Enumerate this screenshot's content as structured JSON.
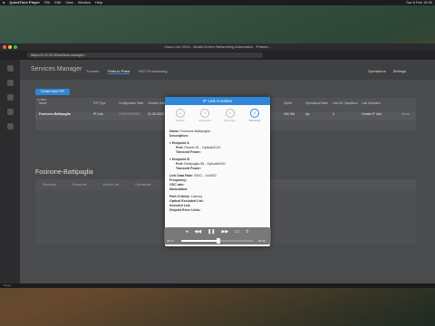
{
  "menubar": {
    "app": "QuickTime Player",
    "items": [
      "File",
      "Edit",
      "View",
      "Window",
      "Help"
    ],
    "clock": "Tue 6 Feb 15:39"
  },
  "browser": {
    "tab_title": "Cisco Live 2024 - Model-Driven Networking Automation - Prasha...",
    "url": "https://10.10.20.50/services-manager/..."
  },
  "app": {
    "title": "Services Manager",
    "tabs": [
      "Tunnels",
      "Point to Point",
      "NSO Provisioning"
    ],
    "active_tab": "Point to Point",
    "header_right": [
      "Operations",
      "Settings"
    ],
    "create_button": "Create New P2P",
    "table": {
      "count": "1 ITEM",
      "headers": [
        "Name",
        "P2P Type",
        "Configuration State",
        "Creation Date",
        "",
        "",
        "",
        "",
        "Speed",
        "Operational State",
        "Last Alt. Operations",
        "Last Operation"
      ],
      "rows": [
        [
          "Fosinone-Battipaglia",
          "IP Link",
          "CONFIGURED",
          "21-02-2024 11:...",
          "",
          "",
          "",
          "",
          "400 GB",
          "Up",
          "2",
          "Create IP Link"
        ]
      ],
      "row_action": "Show"
    },
    "detail": {
      "title": "Fosinone-Battipaglia",
      "tabs": [
        "Summary",
        "Endpoints",
        "Include List",
        "Operations"
      ]
    }
  },
  "modal": {
    "title": "IP Link Creation",
    "steps": [
      {
        "num": "1",
        "label": "Details"
      },
      {
        "num": "2",
        "label": "Endpoints"
      },
      {
        "num": "3",
        "label": "Recovery"
      },
      {
        "num": "4",
        "label": "Summary"
      }
    ],
    "summary": {
      "name_label": "Name:",
      "name_value": "Fosinone-Battipaglia",
      "desc_label": "Description:",
      "endpoint_a": {
        "title": "Endpoint A",
        "port_label": "Port:",
        "port_value": "Roseto 51 - Optical/0/1/3",
        "power_label": "Transmit Power:"
      },
      "endpoint_b": {
        "title": "Endpoint B",
        "port_label": "Port:",
        "port_value": "Battipaglia 58 - Optical/0/0/0",
        "power_label": "Transmit Power:"
      },
      "rate_label": "Link Data Rate:",
      "rate_value": "400G - 1x400G",
      "freq_label": "Frequency:",
      "osnr_label": "OSC rate:",
      "mod_label": "Modulation:",
      "path_label": "Path Criteria:",
      "path_value": "Latency",
      "excluded_label": "Optical Excluded List:",
      "included_label": "Included List:",
      "disjoint_label": "Disjoint Error Links:"
    }
  },
  "player": {
    "elapsed": "06:17",
    "remaining": "-06:38",
    "progress": 0.51
  },
  "statusbar": "Ready"
}
